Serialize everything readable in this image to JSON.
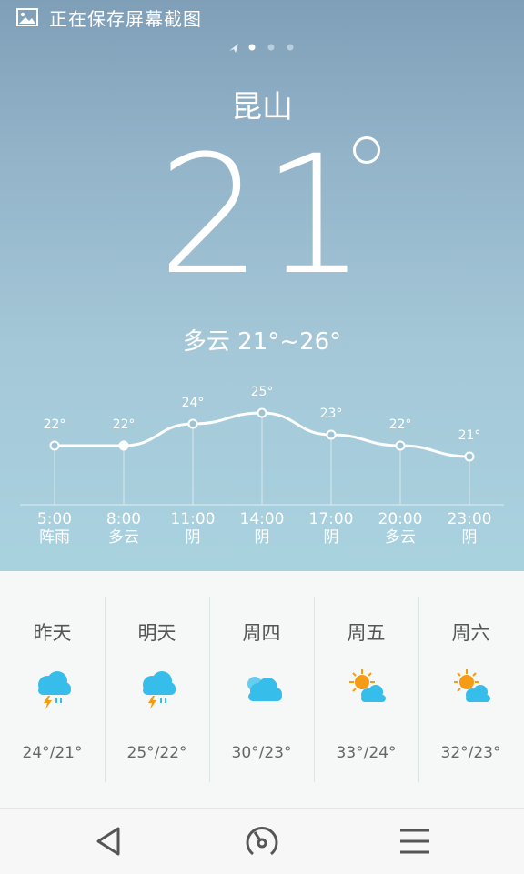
{
  "status": {
    "text": "正在保存屏幕截图",
    "icon": "image-icon"
  },
  "city": "昆山",
  "current_temp": "21",
  "summary": "多云 21°~26°",
  "hourly": [
    {
      "time": "5:00",
      "cond": "阵雨",
      "temp_label": "22°",
      "temp": 22
    },
    {
      "time": "8:00",
      "cond": "多云",
      "temp_label": "22°",
      "temp": 22
    },
    {
      "time": "11:00",
      "cond": "阴",
      "temp_label": "24°",
      "temp": 24
    },
    {
      "time": "14:00",
      "cond": "阴",
      "temp_label": "25°",
      "temp": 25
    },
    {
      "time": "17:00",
      "cond": "阴",
      "temp_label": "23°",
      "temp": 23
    },
    {
      "time": "20:00",
      "cond": "多云",
      "temp_label": "22°",
      "temp": 22
    },
    {
      "time": "23:00",
      "cond": "阴",
      "temp_label": "21°",
      "temp": 21
    }
  ],
  "daily": [
    {
      "day": "昨天",
      "range": "24°/21°",
      "icon": "thunder-rain-icon"
    },
    {
      "day": "明天",
      "range": "25°/22°",
      "icon": "thunder-rain-icon"
    },
    {
      "day": "周四",
      "range": "30°/23°",
      "icon": "cloudy-icon"
    },
    {
      "day": "周五",
      "range": "33°/24°",
      "icon": "partly-sunny-icon"
    },
    {
      "day": "周六",
      "range": "32°/23°",
      "icon": "partly-sunny-icon"
    }
  ],
  "nav": [
    "back-icon",
    "speedometer-icon",
    "menu-icon"
  ],
  "colors": {
    "cloud": "#37bde9",
    "sun": "#f59b16",
    "bolt": "#f39c12"
  }
}
